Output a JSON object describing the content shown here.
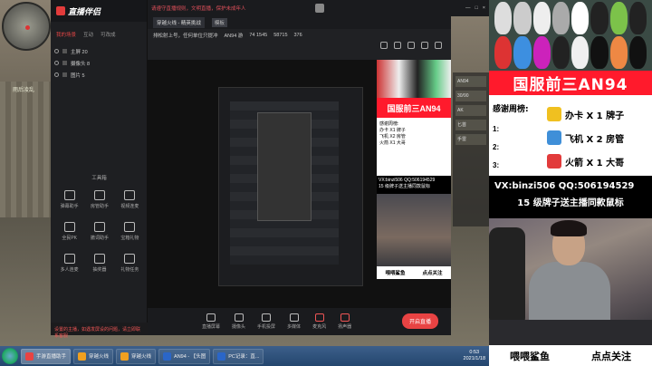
{
  "app": {
    "logo": "直播伴侣",
    "tabs": [
      "我的场景",
      "互动",
      "可改成"
    ],
    "scenes": [
      "主屏 20",
      "摄像头 8",
      "图片 5"
    ],
    "tools_title": "工具箱",
    "tools": [
      "弹幕助手",
      "房管助手",
      "视频连麦",
      "全民PK",
      "撤词助手",
      "宝箱礼物",
      "多人连麦",
      "抽奖器",
      "礼物任务"
    ],
    "status": "设置的主播，如遇发屏设的问题，请立即联系客服"
  },
  "topbar": {
    "notice": "请遵守直播规则，文明直播，保护未成年人",
    "window_controls": [
      "—",
      "□",
      "×"
    ]
  },
  "preview": {
    "room": "穿越火线 - 精英挑战",
    "badge": "模板",
    "sub_title": "排松射上号，任何单位只提冲",
    "stats": [
      "AN94 游",
      "74 1545",
      "58715",
      "376"
    ],
    "bottom_buttons": [
      "直播屏幕",
      "摄像头",
      "手机投屏",
      "多媒体",
      "麦克风",
      "扬声器"
    ],
    "go_live": "开启直播"
  },
  "mini": {
    "title": "国服前三AN94",
    "thanks": "感谢周榜:",
    "gifts": [
      "办卡 X1 牌子",
      "飞机 X2 房管",
      "火箭 X1 大哥"
    ],
    "vx": "VX:binzi506  QQ:506194529",
    "sub": "15 级牌子送主播同款鼠标",
    "footer": [
      "喂喂鲨鱼",
      "点点关注"
    ]
  },
  "stream": {
    "title": "国服前三AN94",
    "thanks_label": "感谢周榜:",
    "rank_dots": [
      "1:",
      "2:",
      "3:"
    ],
    "gifts": [
      {
        "text": "办卡 X 1 牌子",
        "icon": "card-icon",
        "color": "#f0c020"
      },
      {
        "text": "飞机 X 2 房管",
        "icon": "plane-icon",
        "color": "#3f8fd8"
      },
      {
        "text": "火箭 X 1 大哥",
        "icon": "rocket-icon",
        "color": "#e23b3b"
      }
    ],
    "vx_line": "VX:binzi506  QQ:506194529",
    "promo_line": "15 级牌子送主播同款鼠标",
    "footer_left": "喂喂鲨鱼",
    "footer_right": "点点关注"
  },
  "game": {
    "player_name": "雨后凌乱",
    "hud_rows": [
      "AN94",
      "30/90",
      "AK",
      "匕首",
      "手雷"
    ]
  },
  "taskbar": {
    "tasks": [
      {
        "label": "手游直播助手",
        "color": "#e84343",
        "active": true
      },
      {
        "label": "穿越火线",
        "color": "#f0a020",
        "active": false
      },
      {
        "label": "穿越火线",
        "color": "#f0a020",
        "active": false
      },
      {
        "label": "AN94 - 【头图",
        "color": "#2a66c8",
        "active": false
      },
      {
        "label": "PC记录：直...",
        "color": "#2a66c8",
        "active": false
      }
    ],
    "time": "0:53",
    "date": "2021/1/18"
  },
  "colors": {
    "accent_red": "#ff1a2c",
    "dark_panel": "#1e1f22"
  }
}
